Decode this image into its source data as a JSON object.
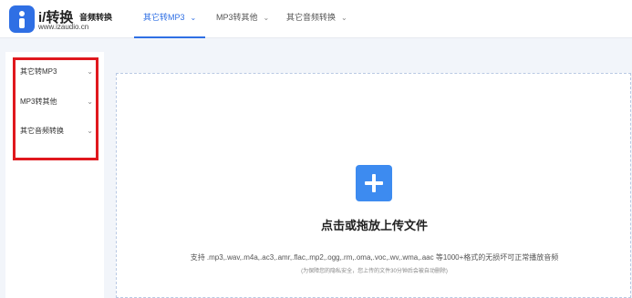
{
  "logo": {
    "brand": "i/转换",
    "subtitle": "音频转换",
    "url": "www.izaudio.cn"
  },
  "nav": {
    "tabs": [
      {
        "label": "其它转MP3"
      },
      {
        "label": "MP3转其他"
      },
      {
        "label": "其它音频转换"
      }
    ]
  },
  "sidebar": {
    "items": [
      {
        "label": "其它转MP3"
      },
      {
        "label": "MP3转其他"
      },
      {
        "label": "其它音频转换"
      }
    ]
  },
  "upload": {
    "title": "点击或拖放上传文件",
    "formats": "支持 .mp3,.wav,.m4a,.ac3,.amr,.flac,.mp2,.ogg,.rm,.oma,.voc,.wv,.wma,.aac 等1000+格式的无损坏可正常播放音频",
    "note": "(为保障您的隐私安全，您上传的文件30分钟后会被自动删除)"
  },
  "colors": {
    "accent": "#2f6fe4",
    "highlight": "#e0181e"
  }
}
